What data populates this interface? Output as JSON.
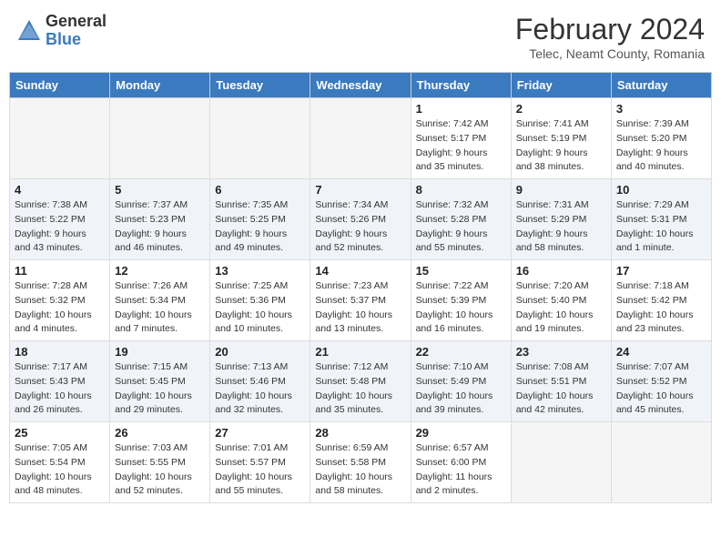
{
  "logo": {
    "general": "General",
    "blue": "Blue"
  },
  "title": "February 2024",
  "subtitle": "Telec, Neamt County, Romania",
  "days_of_week": [
    "Sunday",
    "Monday",
    "Tuesday",
    "Wednesday",
    "Thursday",
    "Friday",
    "Saturday"
  ],
  "weeks": [
    [
      {
        "day": "",
        "info": ""
      },
      {
        "day": "",
        "info": ""
      },
      {
        "day": "",
        "info": ""
      },
      {
        "day": "",
        "info": ""
      },
      {
        "day": "1",
        "info": "Sunrise: 7:42 AM\nSunset: 5:17 PM\nDaylight: 9 hours\nand 35 minutes."
      },
      {
        "day": "2",
        "info": "Sunrise: 7:41 AM\nSunset: 5:19 PM\nDaylight: 9 hours\nand 38 minutes."
      },
      {
        "day": "3",
        "info": "Sunrise: 7:39 AM\nSunset: 5:20 PM\nDaylight: 9 hours\nand 40 minutes."
      }
    ],
    [
      {
        "day": "4",
        "info": "Sunrise: 7:38 AM\nSunset: 5:22 PM\nDaylight: 9 hours\nand 43 minutes."
      },
      {
        "day": "5",
        "info": "Sunrise: 7:37 AM\nSunset: 5:23 PM\nDaylight: 9 hours\nand 46 minutes."
      },
      {
        "day": "6",
        "info": "Sunrise: 7:35 AM\nSunset: 5:25 PM\nDaylight: 9 hours\nand 49 minutes."
      },
      {
        "day": "7",
        "info": "Sunrise: 7:34 AM\nSunset: 5:26 PM\nDaylight: 9 hours\nand 52 minutes."
      },
      {
        "day": "8",
        "info": "Sunrise: 7:32 AM\nSunset: 5:28 PM\nDaylight: 9 hours\nand 55 minutes."
      },
      {
        "day": "9",
        "info": "Sunrise: 7:31 AM\nSunset: 5:29 PM\nDaylight: 9 hours\nand 58 minutes."
      },
      {
        "day": "10",
        "info": "Sunrise: 7:29 AM\nSunset: 5:31 PM\nDaylight: 10 hours\nand 1 minute."
      }
    ],
    [
      {
        "day": "11",
        "info": "Sunrise: 7:28 AM\nSunset: 5:32 PM\nDaylight: 10 hours\nand 4 minutes."
      },
      {
        "day": "12",
        "info": "Sunrise: 7:26 AM\nSunset: 5:34 PM\nDaylight: 10 hours\nand 7 minutes."
      },
      {
        "day": "13",
        "info": "Sunrise: 7:25 AM\nSunset: 5:36 PM\nDaylight: 10 hours\nand 10 minutes."
      },
      {
        "day": "14",
        "info": "Sunrise: 7:23 AM\nSunset: 5:37 PM\nDaylight: 10 hours\nand 13 minutes."
      },
      {
        "day": "15",
        "info": "Sunrise: 7:22 AM\nSunset: 5:39 PM\nDaylight: 10 hours\nand 16 minutes."
      },
      {
        "day": "16",
        "info": "Sunrise: 7:20 AM\nSunset: 5:40 PM\nDaylight: 10 hours\nand 19 minutes."
      },
      {
        "day": "17",
        "info": "Sunrise: 7:18 AM\nSunset: 5:42 PM\nDaylight: 10 hours\nand 23 minutes."
      }
    ],
    [
      {
        "day": "18",
        "info": "Sunrise: 7:17 AM\nSunset: 5:43 PM\nDaylight: 10 hours\nand 26 minutes."
      },
      {
        "day": "19",
        "info": "Sunrise: 7:15 AM\nSunset: 5:45 PM\nDaylight: 10 hours\nand 29 minutes."
      },
      {
        "day": "20",
        "info": "Sunrise: 7:13 AM\nSunset: 5:46 PM\nDaylight: 10 hours\nand 32 minutes."
      },
      {
        "day": "21",
        "info": "Sunrise: 7:12 AM\nSunset: 5:48 PM\nDaylight: 10 hours\nand 35 minutes."
      },
      {
        "day": "22",
        "info": "Sunrise: 7:10 AM\nSunset: 5:49 PM\nDaylight: 10 hours\nand 39 minutes."
      },
      {
        "day": "23",
        "info": "Sunrise: 7:08 AM\nSunset: 5:51 PM\nDaylight: 10 hours\nand 42 minutes."
      },
      {
        "day": "24",
        "info": "Sunrise: 7:07 AM\nSunset: 5:52 PM\nDaylight: 10 hours\nand 45 minutes."
      }
    ],
    [
      {
        "day": "25",
        "info": "Sunrise: 7:05 AM\nSunset: 5:54 PM\nDaylight: 10 hours\nand 48 minutes."
      },
      {
        "day": "26",
        "info": "Sunrise: 7:03 AM\nSunset: 5:55 PM\nDaylight: 10 hours\nand 52 minutes."
      },
      {
        "day": "27",
        "info": "Sunrise: 7:01 AM\nSunset: 5:57 PM\nDaylight: 10 hours\nand 55 minutes."
      },
      {
        "day": "28",
        "info": "Sunrise: 6:59 AM\nSunset: 5:58 PM\nDaylight: 10 hours\nand 58 minutes."
      },
      {
        "day": "29",
        "info": "Sunrise: 6:57 AM\nSunset: 6:00 PM\nDaylight: 11 hours\nand 2 minutes."
      },
      {
        "day": "",
        "info": ""
      },
      {
        "day": "",
        "info": ""
      }
    ]
  ]
}
